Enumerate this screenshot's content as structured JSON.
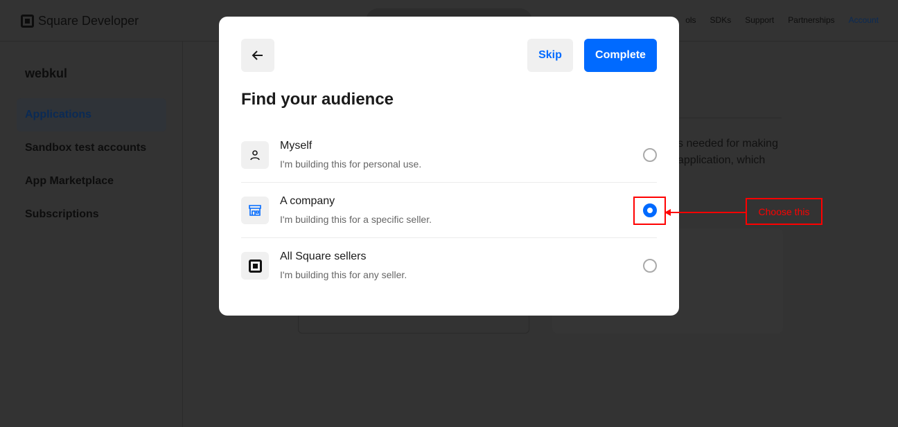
{
  "header": {
    "logo": "Square Developer",
    "nav": [
      "ols",
      "SDKs",
      "Support",
      "Partnerships",
      "Account"
    ]
  },
  "sidebar": {
    "org": "webkul",
    "items": [
      {
        "label": "Applications",
        "active": true
      },
      {
        "label": "Sandbox test accounts"
      },
      {
        "label": "App Marketplace"
      },
      {
        "label": "Subscriptions"
      }
    ]
  },
  "background": {
    "line1": "s needed for making",
    "line2": "application, which"
  },
  "modal": {
    "skip": "Skip",
    "complete": "Complete",
    "title": "Find your audience",
    "options": [
      {
        "title": "Myself",
        "subtitle": "I'm building this for personal use.",
        "icon": "person-icon",
        "selected": false
      },
      {
        "title": "A company",
        "subtitle": "I'm building this for a specific seller.",
        "icon": "storefront-icon",
        "selected": true
      },
      {
        "title": "All Square sellers",
        "subtitle": "I'm building this for any seller.",
        "icon": "square-logo-icon",
        "selected": false
      }
    ]
  },
  "annotation": {
    "label": "Choose this",
    "color": "#ff0000"
  },
  "colors": {
    "accent": "#006aff"
  }
}
